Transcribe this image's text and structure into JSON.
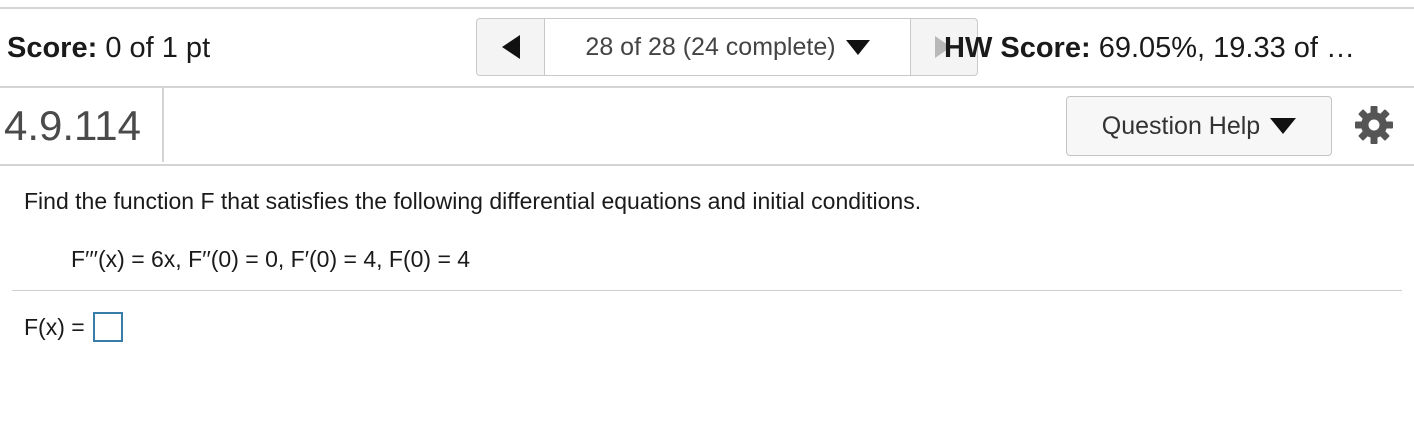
{
  "header": {
    "score_label": "Score:",
    "score_value": " 0 of 1 pt",
    "nav_position": "28 of 28 (24 complete)",
    "hw_score_label": "HW Score:",
    "hw_score_value": " 69.05%, 19.33 of …"
  },
  "question": {
    "id": "4.9.114",
    "help_label": "Question Help",
    "prompt": "Find the function F that satisfies the following differential equations and initial conditions.",
    "equation": "F′′′(x) = 6x, F′′(0) = 0, F′(0) = 4, F(0) = 4",
    "answer_label": "F(x) ="
  },
  "icons": {
    "prev": "triangle-left-icon",
    "dropdown": "triangle-down-icon",
    "next": "triangle-right-icon",
    "settings": "gear-icon"
  },
  "colors": {
    "answer_box_border": "#3a7ca8",
    "divider": "#d4d4d4"
  }
}
